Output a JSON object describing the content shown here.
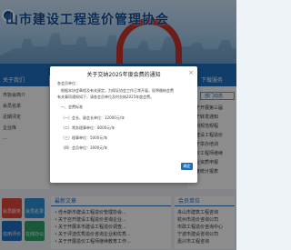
{
  "header": {
    "title": "山市建设工程造价管理协会"
  },
  "left_col": {
    "head": "关于我们",
    "lines": [
      "市协会简介",
      "会员名单",
      "近期评定",
      "企业库",
      "..."
    ]
  },
  "right_col": {
    "head": "下载服务",
    "button": "部门动态",
    "lines": [
      "关于开展第三届",
      "关于转发通知",
      "编制规范规程",
      "市建设工程造价",
      "关于举办培训",
      "造价工程师继续",
      "企业资质申报",
      "年度统计报表"
    ]
  },
  "tiles": [
    "会员服务",
    "会员名录",
    "信用评价",
    "在线办公"
  ],
  "news": {
    "head": "最新文章",
    "items": [
      "佳木斯市建设工程造价管理协会...",
      "关于召开建设工程造价咨询企业...",
      "关于开展本市建设工程造价调查...",
      "关于评选优秀造价咨询企业和优秀...",
      "关于开展造价工程师继续教育工作..."
    ]
  },
  "assoc": {
    "head": "会员单位",
    "items": [
      "舟山市建筑工程咨询",
      "杭州市造价咨询公司",
      "市政工程造价咨询中心",
      "宁波市建设咨询公司",
      "嘉兴市工程咨询"
    ]
  },
  "modal": {
    "title": "关于交纳2025年度会费的通知",
    "close": "×",
    "lines": [
      "各会员单位：",
      "根据本协会章程及有关规定，为保证协会工作正常开展，现将缴纳会费",
      "有关事项通知如下，请各会员单位及时交纳2025年度会费。",
      "一、会费标准",
      "（一）会长、副会长单位：12000元/年",
      "（二）常务理事单位：8000元/年",
      "（三）理事单位：5000元/年",
      "（四）会员单位：3000元/年"
    ],
    "ok": "确定"
  }
}
